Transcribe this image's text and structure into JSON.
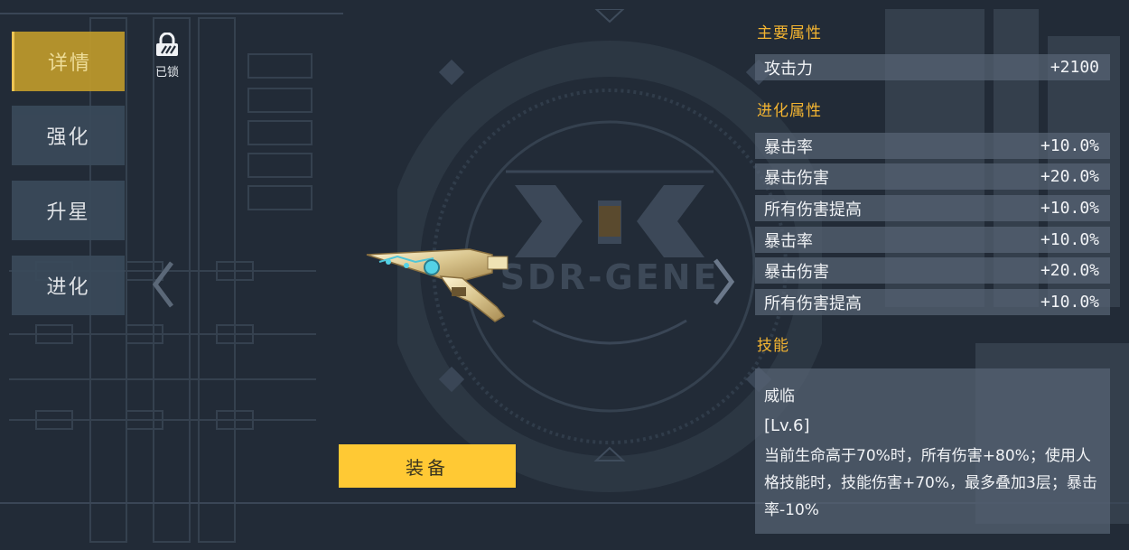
{
  "tabs": [
    {
      "label": "详情",
      "active": true
    },
    {
      "label": "强化",
      "active": false
    },
    {
      "label": "升星",
      "active": false
    },
    {
      "label": "进化",
      "active": false
    }
  ],
  "lock": {
    "label": "已锁",
    "icon": "lock-icon"
  },
  "emblem": {
    "text": "SDR-GENE"
  },
  "equip_button": {
    "label": "装备"
  },
  "main_attributes": {
    "title": "主要属性",
    "items": [
      {
        "name": "攻击力",
        "value": "+2100"
      }
    ]
  },
  "evolution_attributes": {
    "title": "进化属性",
    "items": [
      {
        "name": "暴击率",
        "value": "+10.0%"
      },
      {
        "name": "暴击伤害",
        "value": "+20.0%"
      },
      {
        "name": "所有伤害提高",
        "value": "+10.0%"
      },
      {
        "name": "暴击率",
        "value": "+10.0%"
      },
      {
        "name": "暴击伤害",
        "value": "+20.0%"
      },
      {
        "name": "所有伤害提高",
        "value": "+10.0%"
      }
    ]
  },
  "skill": {
    "title": "技能",
    "name": "威临",
    "level": "[Lv.6]",
    "description": "当前生命高于70%时，所有伤害+80%；使用人格技能时，技能伤害+70%，最多叠加3层；暴击率-10%"
  },
  "colors": {
    "background": "#222b37",
    "accent_gold": "#f3b431",
    "active_tab": "#bf9a2c",
    "equip_button": "#ffc934",
    "row_bg": "#58647 4"
  }
}
